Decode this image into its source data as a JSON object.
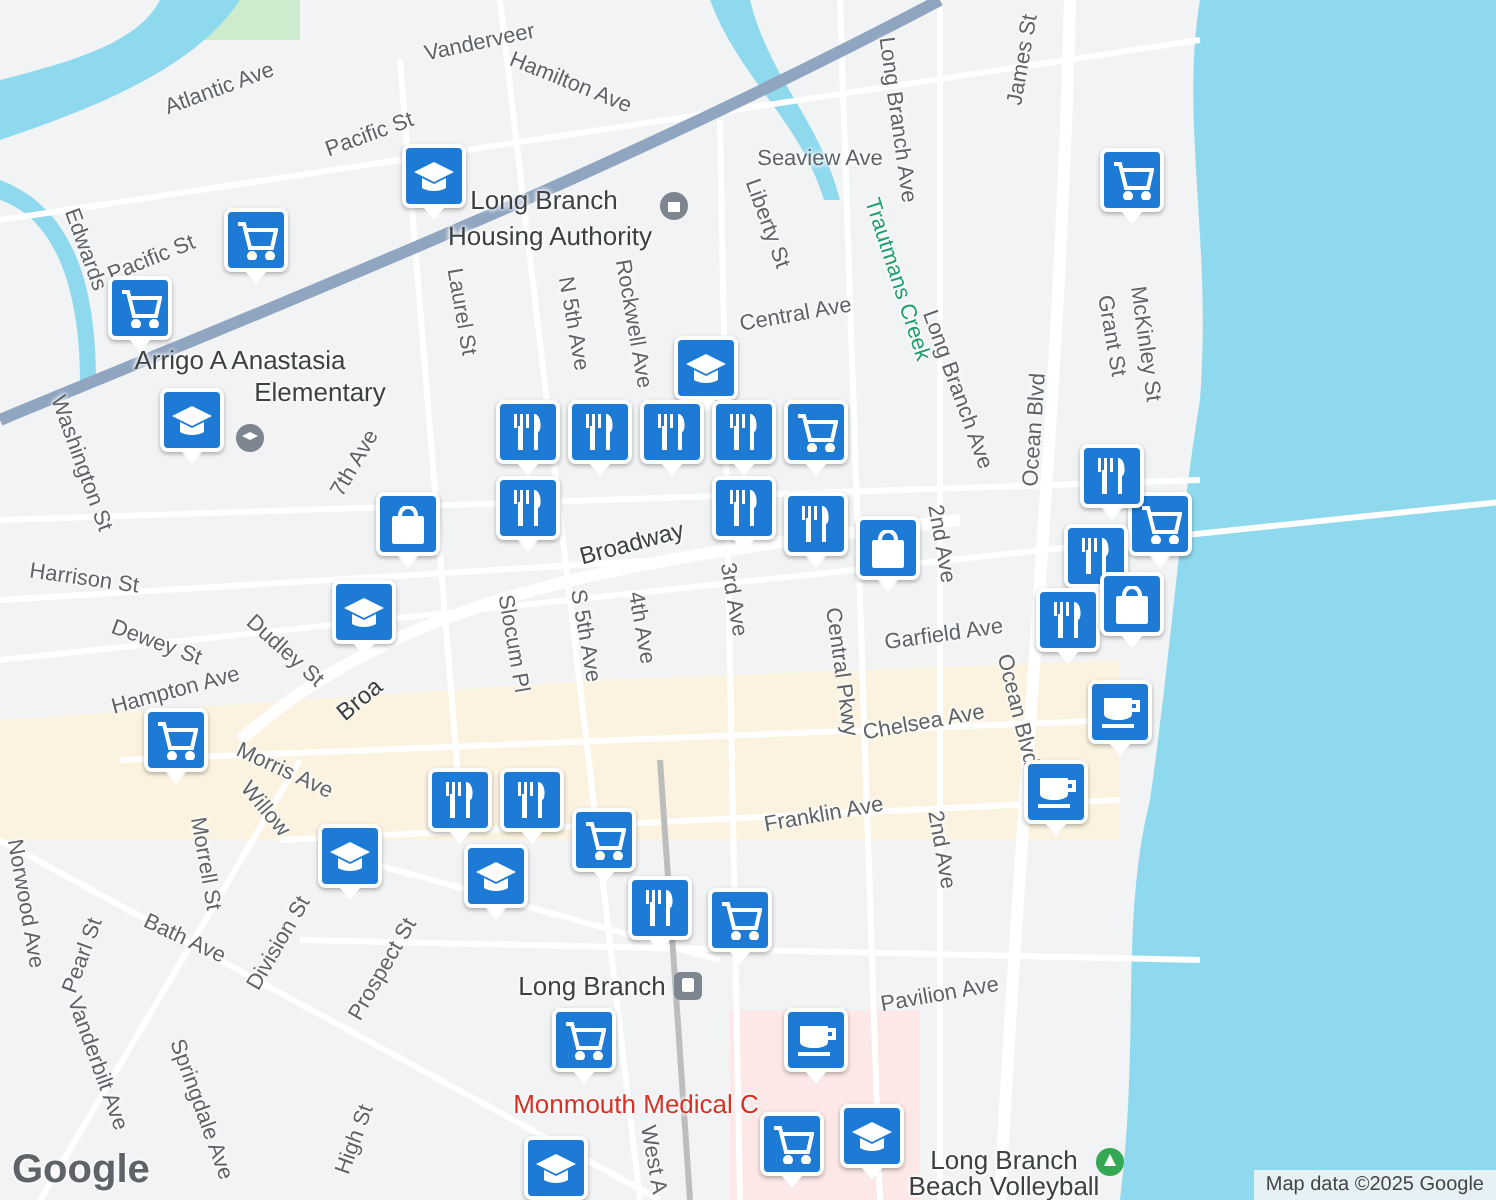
{
  "map": {
    "labels": [
      {
        "text": "Atlantic Ave",
        "kind": "street"
      },
      {
        "text": "Pacific St",
        "kind": "street"
      },
      {
        "text": "Vanderveer",
        "kind": "street"
      },
      {
        "text": "Hamilton Ave",
        "kind": "street"
      },
      {
        "text": "Long Branch",
        "kind": "poi"
      },
      {
        "text": "Housing Authority",
        "kind": "poi"
      },
      {
        "text": "Seaview Ave",
        "kind": "street"
      },
      {
        "text": "Liberty St",
        "kind": "street"
      },
      {
        "text": "Central Ave",
        "kind": "street"
      },
      {
        "text": "Trautmans Creek",
        "kind": "water"
      },
      {
        "text": "Long Branch Ave",
        "kind": "street"
      },
      {
        "text": "Long Branch Ave",
        "kind": "street"
      },
      {
        "text": "James St",
        "kind": "street"
      },
      {
        "text": "Ocean Blvd",
        "kind": "street"
      },
      {
        "text": "Ocean Blvd",
        "kind": "street"
      },
      {
        "text": "Grant St",
        "kind": "street"
      },
      {
        "text": "McKinley St",
        "kind": "street"
      },
      {
        "text": "Edwards",
        "kind": "street"
      },
      {
        "text": "Pacific St",
        "kind": "street"
      },
      {
        "text": "Laurel St",
        "kind": "street"
      },
      {
        "text": "N 5th Ave",
        "kind": "street"
      },
      {
        "text": "Rockwell Ave",
        "kind": "street"
      },
      {
        "text": "Arrigo A Anastasia",
        "kind": "poi"
      },
      {
        "text": "Elementary",
        "kind": "poi"
      },
      {
        "text": "Washington St",
        "kind": "street"
      },
      {
        "text": "7th Ave",
        "kind": "street"
      },
      {
        "text": "Broadway",
        "kind": "major"
      },
      {
        "text": "Slocum Pl",
        "kind": "street"
      },
      {
        "text": "S 5th Ave",
        "kind": "street"
      },
      {
        "text": "4th Ave",
        "kind": "street"
      },
      {
        "text": "3rd Ave",
        "kind": "street"
      },
      {
        "text": "Harrison St",
        "kind": "street"
      },
      {
        "text": "Dewey St",
        "kind": "street"
      },
      {
        "text": "Dudley St",
        "kind": "street"
      },
      {
        "text": "Hampton Ave",
        "kind": "street"
      },
      {
        "text": "Garfield Ave",
        "kind": "street"
      },
      {
        "text": "2nd Ave",
        "kind": "street"
      },
      {
        "text": "Chelsea Ave",
        "kind": "street"
      },
      {
        "text": "Morris Ave",
        "kind": "street"
      },
      {
        "text": "Franklin Ave",
        "kind": "street"
      },
      {
        "text": "2nd Ave",
        "kind": "street"
      },
      {
        "text": "Willow",
        "kind": "street"
      },
      {
        "text": "Morrell St",
        "kind": "street"
      },
      {
        "text": "Norwood Ave",
        "kind": "street"
      },
      {
        "text": "Bath Ave",
        "kind": "street"
      },
      {
        "text": "Division St",
        "kind": "street"
      },
      {
        "text": "Prospect St",
        "kind": "street"
      },
      {
        "text": "Pearl St",
        "kind": "street"
      },
      {
        "text": "Vanderbilt Ave",
        "kind": "street"
      },
      {
        "text": "Long Branch",
        "kind": "poi"
      },
      {
        "text": "Pavilion Ave",
        "kind": "street"
      },
      {
        "text": "Monmouth Medical C",
        "kind": "medical"
      },
      {
        "text": "Springdale Ave",
        "kind": "street"
      },
      {
        "text": "High St",
        "kind": "street"
      },
      {
        "text": "West A",
        "kind": "street"
      },
      {
        "text": "Long Branch",
        "kind": "poi"
      },
      {
        "text": "Beach Volleyball",
        "kind": "poi"
      },
      {
        "text": "Broa",
        "kind": "major"
      },
      {
        "text": "Central Pkwy",
        "kind": "street"
      }
    ],
    "markers": [
      {
        "kind": "school"
      },
      {
        "kind": "school"
      },
      {
        "kind": "school"
      },
      {
        "kind": "school"
      },
      {
        "kind": "school"
      },
      {
        "kind": "school"
      },
      {
        "kind": "school"
      },
      {
        "kind": "school"
      },
      {
        "kind": "grocery"
      },
      {
        "kind": "grocery"
      },
      {
        "kind": "grocery"
      },
      {
        "kind": "grocery"
      },
      {
        "kind": "grocery"
      },
      {
        "kind": "grocery"
      },
      {
        "kind": "grocery"
      },
      {
        "kind": "grocery"
      },
      {
        "kind": "grocery"
      },
      {
        "kind": "grocery"
      },
      {
        "kind": "restaurant"
      },
      {
        "kind": "restaurant"
      },
      {
        "kind": "restaurant"
      },
      {
        "kind": "restaurant"
      },
      {
        "kind": "restaurant"
      },
      {
        "kind": "restaurant"
      },
      {
        "kind": "restaurant"
      },
      {
        "kind": "restaurant"
      },
      {
        "kind": "restaurant"
      },
      {
        "kind": "restaurant"
      },
      {
        "kind": "restaurant"
      },
      {
        "kind": "restaurant"
      },
      {
        "kind": "restaurant"
      },
      {
        "kind": "shopping"
      },
      {
        "kind": "shopping"
      },
      {
        "kind": "shopping"
      },
      {
        "kind": "cafe"
      },
      {
        "kind": "cafe"
      },
      {
        "kind": "cafe"
      }
    ]
  },
  "logo": "Google",
  "attribution": "Map data ©2025 Google"
}
